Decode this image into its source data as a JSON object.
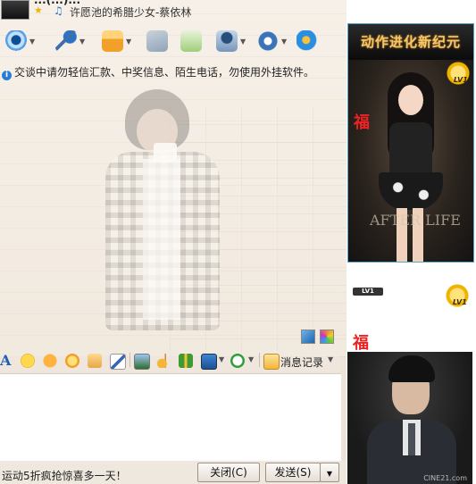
{
  "header": {
    "nickname": "...(...)...",
    "signature": "许愿池的希腊少女-蔡依林"
  },
  "toolbar": {
    "icons": [
      "webcam-icon",
      "microphone-icon",
      "send-file-icon",
      "mail-icon",
      "add-group-icon",
      "app-icon",
      "settings-icon",
      "browser-icon"
    ]
  },
  "notice": {
    "text": "交谈中请勿轻信汇款、中奖信息、陌生电话，勿使用外挂软件。"
  },
  "format_toolbar": {
    "font_label": "A",
    "history_label": "消息记录"
  },
  "status": {
    "ad_text": "运动5折疯抢惊喜多一天！"
  },
  "buttons": {
    "close": "关闭(C)",
    "send": "发送(S)"
  },
  "ads": {
    "ad1_banner": "动作进化新纪元",
    "ad1_logo": "AFTER LIFE",
    "lv": "LV1",
    "fu": "福",
    "ad2_tag": "LV1",
    "watermark": "CINE21.com"
  },
  "colors": {
    "accent": "#1f5fb8",
    "ad_banner_text": "#f2c96a",
    "ad_border": "#5aa3c9"
  }
}
